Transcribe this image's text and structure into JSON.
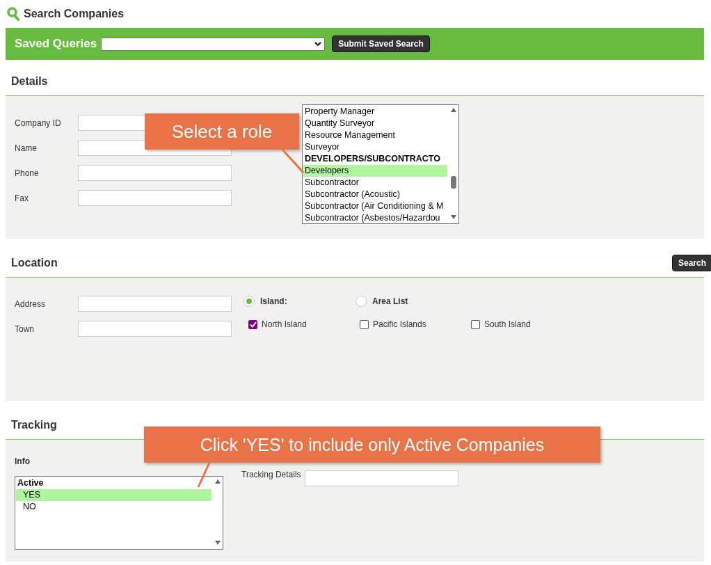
{
  "page_title": "Search Companies",
  "saved_queries": {
    "label": "Saved Queries",
    "button": "Submit Saved Search"
  },
  "details": {
    "heading": "Details",
    "fields": [
      {
        "label": "Company ID"
      },
      {
        "label": "Name"
      },
      {
        "label": "Phone"
      },
      {
        "label": "Fax"
      }
    ],
    "roles": [
      {
        "label": "Property Manager",
        "kind": "item",
        "selected": false
      },
      {
        "label": "Quantity Surveyor",
        "kind": "item",
        "selected": false
      },
      {
        "label": "Resource Management",
        "kind": "item",
        "selected": false
      },
      {
        "label": "Surveyor",
        "kind": "item",
        "selected": false
      },
      {
        "label": "DEVELOPERS/SUBCONTRACTO",
        "kind": "group",
        "selected": false
      },
      {
        "label": "Developers",
        "kind": "item",
        "selected": true
      },
      {
        "label": "Subcontractor",
        "kind": "item",
        "selected": false
      },
      {
        "label": "Subcontractor (Acoustic)",
        "kind": "item",
        "selected": false
      },
      {
        "label": "Subcontractor (Air Conditioning & M",
        "kind": "item",
        "selected": false
      },
      {
        "label": "Subcontractor (Asbestos/Hazardou",
        "kind": "item",
        "selected": false
      }
    ]
  },
  "location": {
    "heading": "Location",
    "search_button": "Search",
    "fields": [
      {
        "label": "Address"
      },
      {
        "label": "Town"
      }
    ],
    "modes": [
      {
        "label": "Island:",
        "selected": true
      },
      {
        "label": "Area List",
        "selected": false
      }
    ],
    "islands": [
      {
        "label": "North Island",
        "checked": true
      },
      {
        "label": "Pacific Islands",
        "checked": false
      },
      {
        "label": "South Island",
        "checked": false
      }
    ]
  },
  "tracking": {
    "heading": "Tracking",
    "info_label": "Info",
    "details_label": "Tracking Details",
    "info_options": [
      {
        "label": "Active",
        "kind": "group",
        "selected": false
      },
      {
        "label": "YES",
        "kind": "item",
        "selected": true
      },
      {
        "label": "NO",
        "kind": "item",
        "selected": false
      }
    ]
  },
  "callouts": [
    {
      "text": "Select a role"
    },
    {
      "text": "Click 'YES' to include only Active Companies"
    }
  ]
}
